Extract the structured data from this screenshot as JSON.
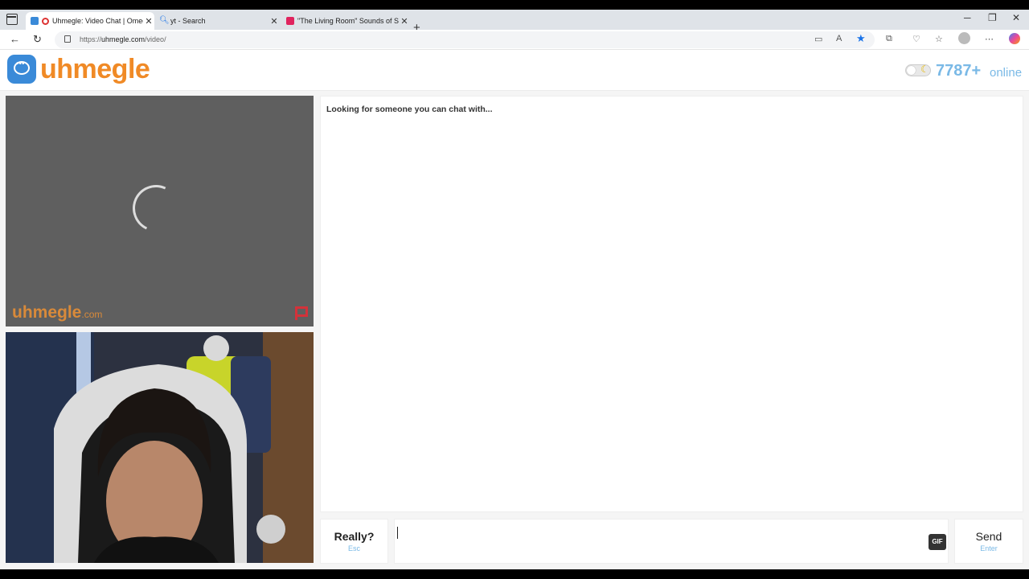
{
  "browser": {
    "tabs": [
      {
        "title": "Uhmegle: Video Chat | Omegle",
        "active": true
      },
      {
        "title": "yt - Search",
        "active": false
      },
      {
        "title": "\"The Living Room\" Sounds of Sha",
        "active": false
      }
    ],
    "url_prefix": "https://",
    "url_host": "uhmegle.com",
    "url_path": "/video/"
  },
  "header": {
    "logo_text": "uhmegle",
    "online_count": "7787+",
    "online_label": "online"
  },
  "video": {
    "watermark_main": "uhmegle",
    "watermark_suffix": ".com"
  },
  "chat": {
    "status": "Looking for someone you can chat with..."
  },
  "controls": {
    "skip_label": "Really?",
    "skip_key": "Esc",
    "gif_label": "GIF",
    "send_label": "Send",
    "send_key": "Enter"
  },
  "colors": {
    "brand_orange": "#f08a26",
    "brand_blue": "#3a8ad8",
    "online_blue": "#7ab9e6"
  }
}
